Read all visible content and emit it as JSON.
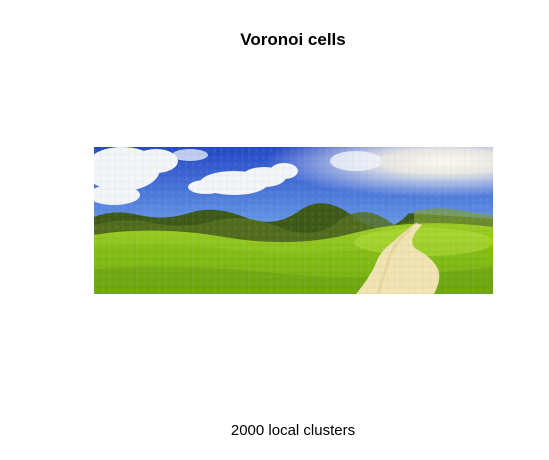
{
  "figure": {
    "title": "Voronoi cells",
    "caption": "2000 local clusters"
  },
  "image": {
    "depicts": "voronoi-mosaic-landscape",
    "colors": {
      "sky_top": "#2a55d6",
      "sky_mid": "#5b8ee6",
      "cloud": "#f4f6fb",
      "sun_glow": "#fff9e8",
      "trees_dark": "#2f4a14",
      "trees_mid": "#5f7a22",
      "grass_light": "#a6d62a",
      "grass_mid": "#86c216",
      "grass_dark": "#5c8e10",
      "path": "#f2e6b6"
    }
  }
}
